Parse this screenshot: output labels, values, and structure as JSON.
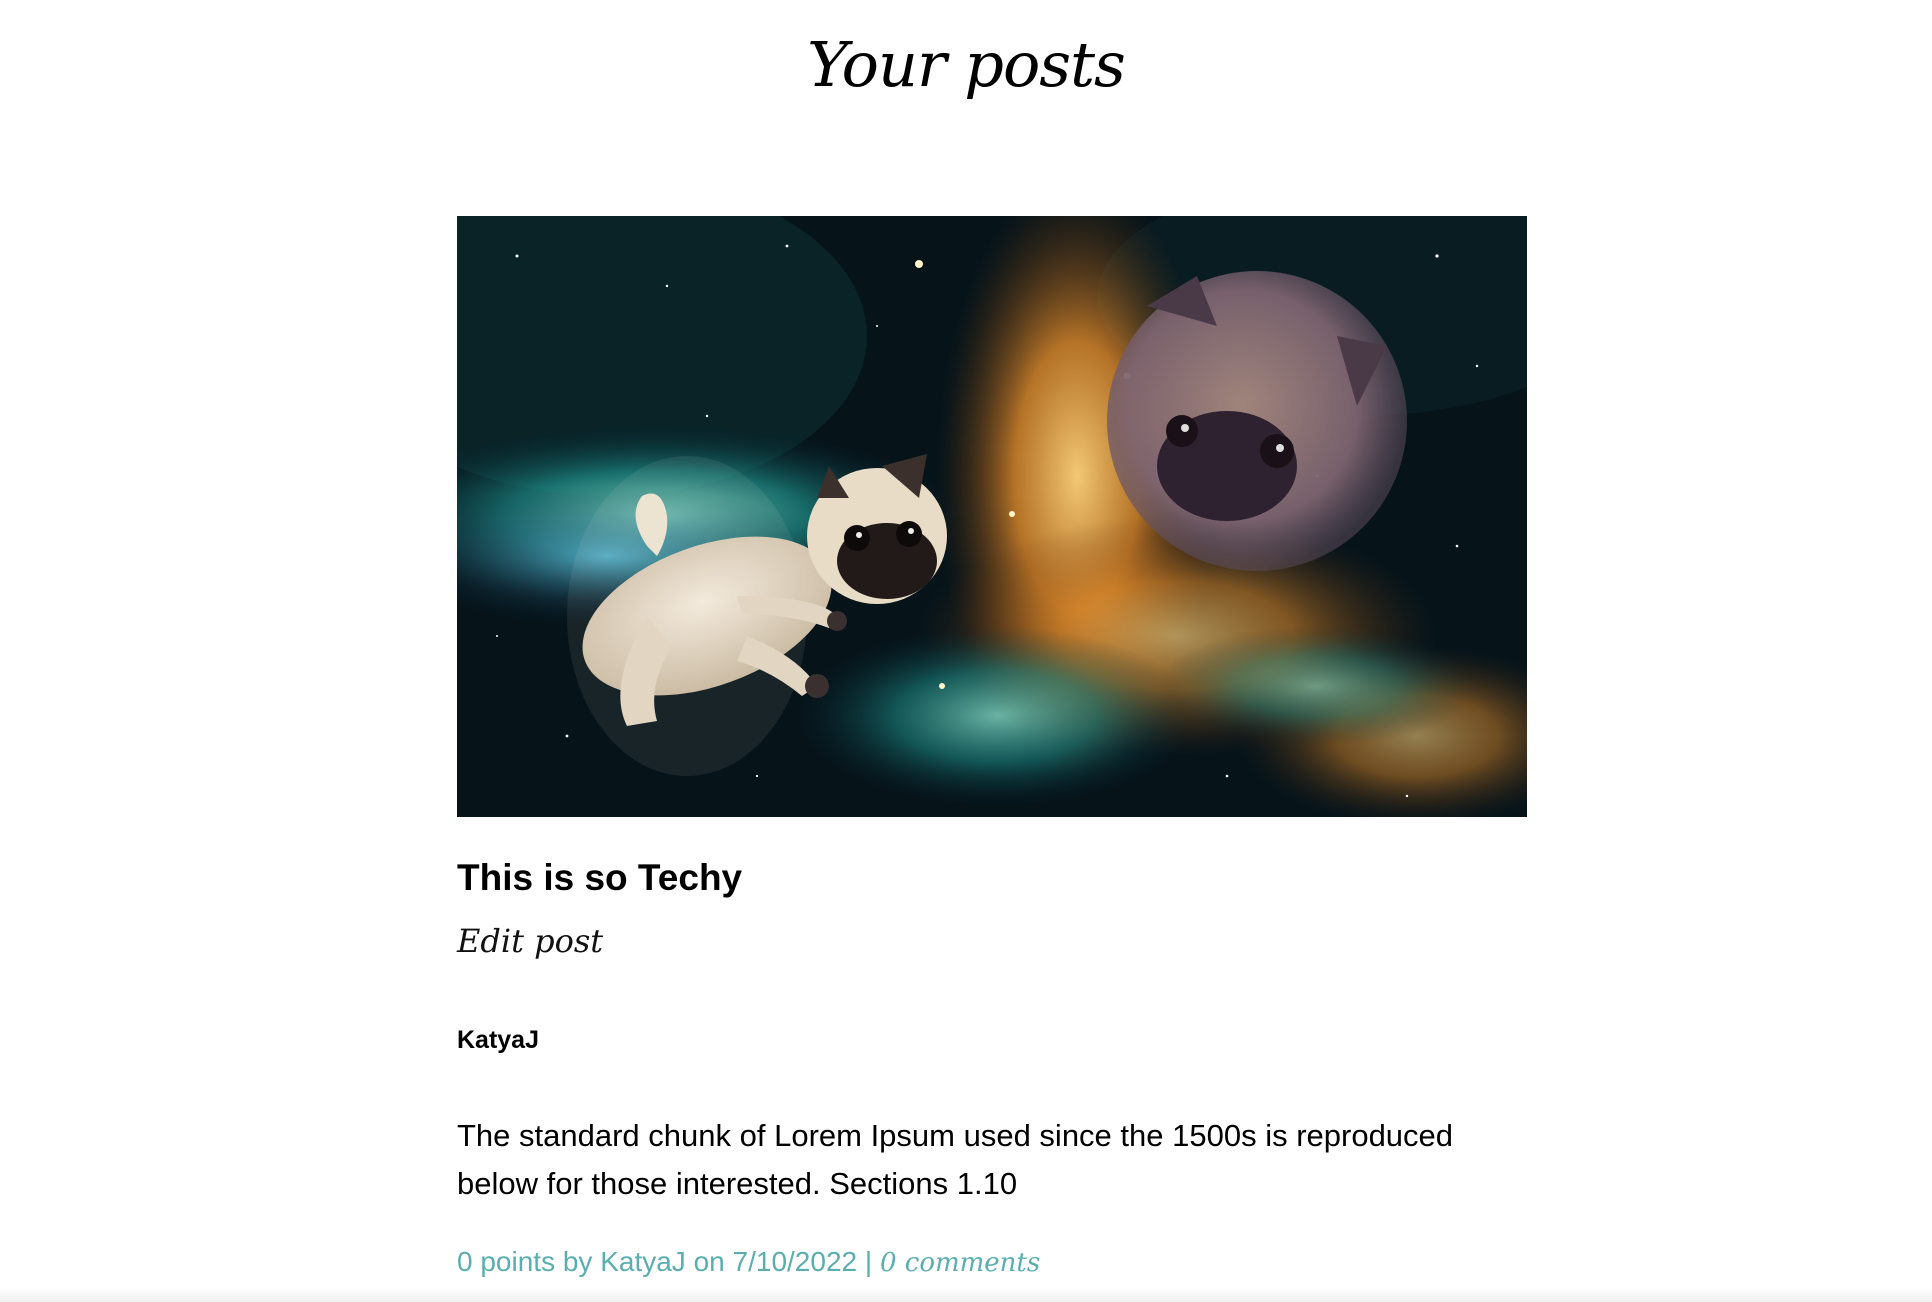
{
  "page": {
    "title": "Your posts"
  },
  "post": {
    "image_alt": "Pugs floating in a colorful space nebula",
    "title": "This is so Techy",
    "edit_label": "Edit post",
    "author": "KatyaJ",
    "body": "The standard chunk of Lorem Ipsum used since the 1500s is reproduced below for those interested. Sections 1.10",
    "meta": {
      "points_text": "0 points by",
      "author": "KatyaJ",
      "on_text": "on",
      "date": "7/10/2022",
      "separator": "|",
      "comments_label": "0 comments"
    }
  },
  "colors": {
    "link": "#5aaeb0",
    "text": "#000000",
    "background": "#ffffff"
  }
}
